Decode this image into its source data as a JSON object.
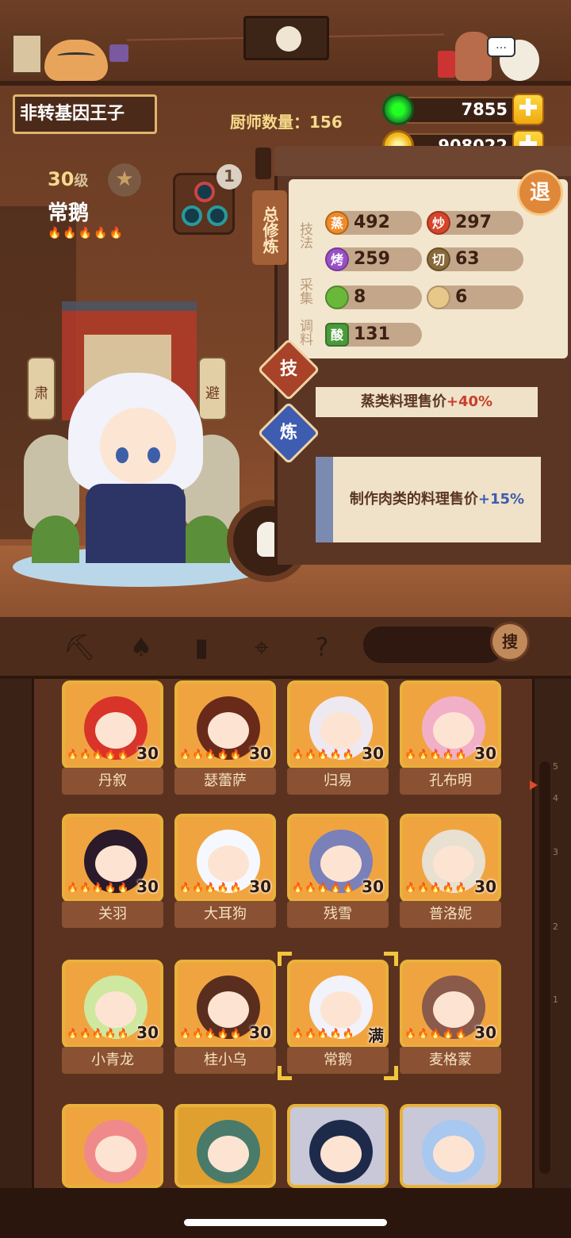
{
  "header": {
    "name_title": "非转基因王子",
    "chef_count": "厨师数量：156",
    "jade_count": "7855",
    "coin_count": "908022",
    "plus_glyph": "✚",
    "back_label": "退"
  },
  "chef": {
    "level": "30",
    "level_unit": "级",
    "rarity": "常鹅",
    "flames": "🔥🔥🔥🔥🔥",
    "glass_badge": "1"
  },
  "panel": {
    "tab_label": "总修炼",
    "cat_technique": "技法",
    "cat_gather": "采集",
    "cat_season": "调料",
    "stats": [
      {
        "icon": "蒸",
        "value": "492",
        "color": "#f08a28"
      },
      {
        "icon": "炒",
        "value": "297",
        "color": "#d6452a"
      },
      {
        "icon": "烤",
        "value": "259",
        "color": "#9a4fc8"
      },
      {
        "icon": "切",
        "value": "63",
        "color": "#8a6a3a"
      },
      {
        "icon": "",
        "value": "8",
        "color": "#6ab83a"
      },
      {
        "icon": "",
        "value": "6",
        "color": "#e8c88a"
      },
      {
        "icon": "酸",
        "value": "131",
        "color": "#4a9a3a"
      }
    ],
    "skill_tag": "技",
    "refine_tag": "炼",
    "skill_text": "蒸类料理售价",
    "skill_bonus": "+40%",
    "refine_text": "制作肉类的料理售价",
    "refine_bonus": "+15%"
  },
  "toolbar": {
    "search_label": "搜"
  },
  "scroll_marks": [
    "5",
    "4",
    "3",
    "2",
    "1"
  ],
  "chefs": [
    {
      "name": "丹叙",
      "level": "30",
      "hair": "#d8342a",
      "bg": "#f0a440"
    },
    {
      "name": "瑟蕾萨",
      "level": "30",
      "hair": "#6a2a1a",
      "bg": "#f0a440"
    },
    {
      "name": "归易",
      "level": "30",
      "hair": "#eee8f0",
      "bg": "#f0a440"
    },
    {
      "name": "孔布明",
      "level": "30",
      "hair": "#f2b0c8",
      "bg": "#f0a440"
    },
    {
      "name": "关羽",
      "level": "30",
      "hair": "#2a1a2a",
      "bg": "#f0a440"
    },
    {
      "name": "大耳狗",
      "level": "30",
      "hair": "#f6f8ff",
      "bg": "#f0a440"
    },
    {
      "name": "残雪",
      "level": "30",
      "hair": "#7a80b8",
      "bg": "#f0a440"
    },
    {
      "name": "普洛妮",
      "level": "30",
      "hair": "#e8e0d0",
      "bg": "#f0a440"
    },
    {
      "name": "小青龙",
      "level": "30",
      "hair": "#cfe8a0",
      "bg": "#f0a440"
    },
    {
      "name": "桂小乌",
      "level": "30",
      "hair": "#5a2e1e",
      "bg": "#f0a440"
    },
    {
      "name": "常鹅",
      "level": "满",
      "hair": "#f1f2fa",
      "bg": "#f0a440"
    },
    {
      "name": "麦格蒙",
      "level": "30",
      "hair": "#8a5a4a",
      "bg": "#f0a440"
    },
    {
      "name": "",
      "level": "",
      "hair": "#f08a8a",
      "bg": "#f0a440"
    },
    {
      "name": "",
      "level": "",
      "hair": "#4a7a6a",
      "bg": "#e0a030"
    },
    {
      "name": "",
      "level": "",
      "hair": "#1e2a4a",
      "bg": "#c8c8d8"
    },
    {
      "name": "",
      "level": "",
      "hair": "#a8c8f0",
      "bg": "#c8c8d8"
    }
  ]
}
